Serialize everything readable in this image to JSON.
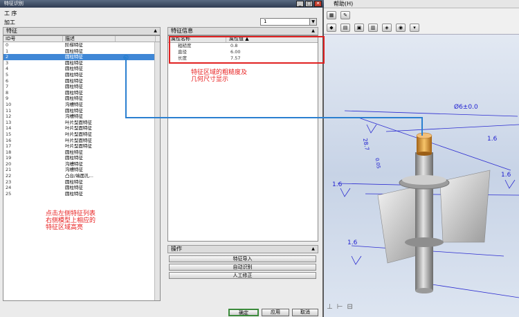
{
  "window": {
    "title": "特征识别"
  },
  "dialog": {
    "process_label": "工 序",
    "machining_label": "加工",
    "machining_value": "1",
    "features_header": "特征",
    "info_header": "特征信息",
    "ops_header": "操作"
  },
  "features": {
    "columns": [
      "ID号",
      "描述",
      ""
    ],
    "rows": [
      [
        "0",
        "阶梯特征"
      ],
      [
        "1",
        "圆柱特征"
      ],
      [
        "2",
        "圆柱特征"
      ],
      [
        "3",
        "圆柱特征"
      ],
      [
        "4",
        "圆柱特征"
      ],
      [
        "5",
        "圆柱特征"
      ],
      [
        "6",
        "圆柱特征"
      ],
      [
        "7",
        "圆柱特征"
      ],
      [
        "8",
        "圆柱特征"
      ],
      [
        "9",
        "圆柱特征"
      ],
      [
        "10",
        "沟槽特征"
      ],
      [
        "11",
        "圆柱特征"
      ],
      [
        "12",
        "沟槽特征"
      ],
      [
        "13",
        "叶片型面特征"
      ],
      [
        "14",
        "叶片型面特征"
      ],
      [
        "15",
        "叶片型面特征"
      ],
      [
        "16",
        "叶片型面特征"
      ],
      [
        "17",
        "叶片型面特征"
      ],
      [
        "18",
        "圆柱特征"
      ],
      [
        "19",
        "圆柱特征"
      ],
      [
        "20",
        "沟槽特征"
      ],
      [
        "21",
        "沟槽特征"
      ],
      [
        "22",
        "凸台/端面孔..."
      ],
      [
        "23",
        "圆柱特征"
      ],
      [
        "24",
        "圆柱特征"
      ],
      [
        "25",
        "圆柱特征"
      ]
    ],
    "selected_index": 2
  },
  "info": {
    "columns": [
      "属性名称",
      "属性值"
    ],
    "rows": [
      [
        "粗糙度",
        "0.8"
      ],
      [
        "直径",
        "6.00"
      ],
      [
        "长度",
        "7.57"
      ]
    ]
  },
  "annotations": {
    "right_note": [
      "特征区域的粗糙度及",
      "几何尺寸显示"
    ],
    "left_note": [
      "点击左侧特征列表",
      "右侧模型上相应的",
      "特征区域高亮"
    ]
  },
  "operations": [
    "特征导入",
    "自动识别",
    "人工修正"
  ],
  "footer": {
    "ok": "确定",
    "apply": "应用",
    "cancel": "取消"
  },
  "cad": {
    "menu": "帮助(H)",
    "dims": [
      "Ø6±0.0",
      "28.7",
      "1.6",
      "1.6",
      "1.6",
      "0.05",
      "1.6"
    ]
  },
  "colors": {
    "selection": "#3f87d6",
    "annotation": "#e02020",
    "leader": "#2a7fd0",
    "dimension": "#2020d0"
  }
}
